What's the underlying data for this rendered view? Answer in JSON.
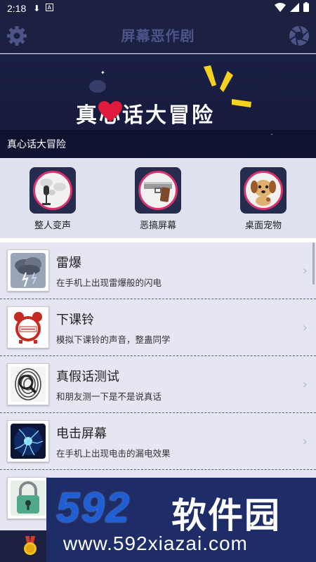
{
  "status_bar": {
    "time": "2:18"
  },
  "app_bar": {
    "title": "屏幕恶作剧",
    "settings_icon": "gear-icon",
    "right_icon": "aperture-icon"
  },
  "banner": {
    "headline": "真心话大冒险",
    "caption": "真心话大冒险"
  },
  "quick_actions": [
    {
      "label": "整人变声",
      "icon": "microphone-icon"
    },
    {
      "label": "恶搞屏幕",
      "icon": "pistol-icon"
    },
    {
      "label": "桌面宠物",
      "icon": "puppy-icon"
    }
  ],
  "list_items": [
    {
      "title": "雷爆",
      "description": "在手机上出现雷爆般的闪电",
      "icon": "storm-cloud-icon"
    },
    {
      "title": "下课铃",
      "description": "模拟下课铃的声音，整蛊同学",
      "icon": "alarm-clock-icon"
    },
    {
      "title": "真假话测试",
      "description": "和朋友测一下是不是说真话",
      "icon": "fingerprint-icon"
    },
    {
      "title": "电击屏幕",
      "description": "在手机上出现电击的漏电效果",
      "icon": "plasma-ball-icon"
    },
    {
      "title": "",
      "description": "",
      "icon": "lock-icon"
    }
  ],
  "watermark": {
    "number": "592",
    "brand": "软件园",
    "url": "www.592xiazai.com"
  },
  "colors": {
    "header_bg": "#1c2142",
    "accent_pink": "#d9316c",
    "list_bg": "#e5e6f2"
  }
}
